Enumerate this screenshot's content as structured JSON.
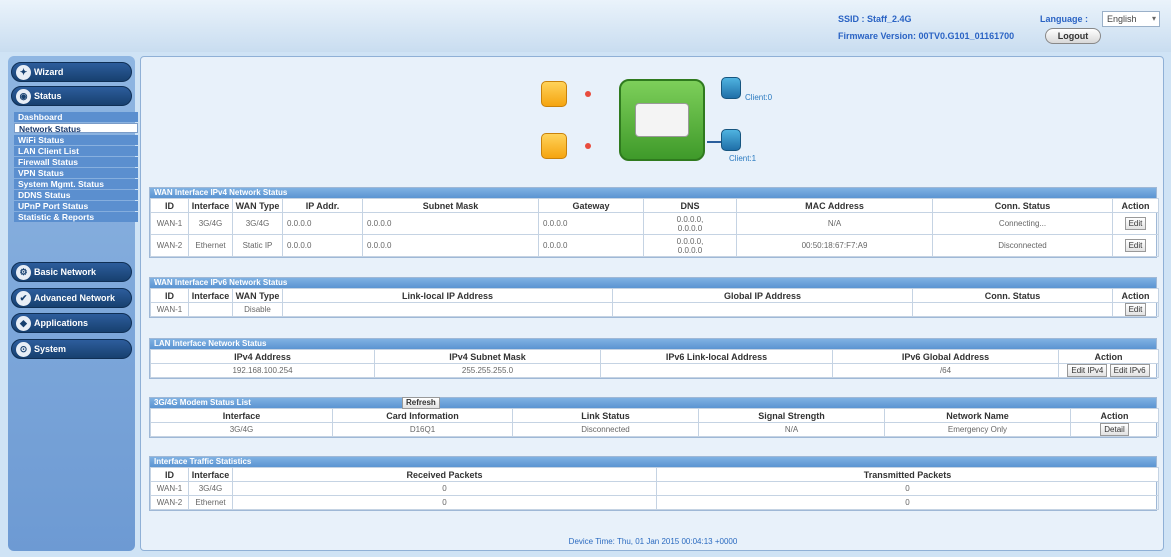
{
  "header": {
    "ssid_label": "SSID : Staff_2.4G",
    "firmware_label": "Firmware Version: 00TV0.G101_01161700",
    "language_label": "Language :",
    "language_value": "English",
    "logout_label": "Logout"
  },
  "sidebar": {
    "wizard": "Wizard",
    "status": "Status",
    "status_items": [
      "Dashboard",
      "Network Status",
      "WiFi Status",
      "LAN Client List",
      "Firewall Status",
      "VPN Status",
      "System Mgmt. Status",
      "DDNS Status",
      "UPnP Port Status",
      "Statistic & Reports"
    ],
    "basic_network": "Basic Network",
    "advanced_network": "Advanced Network",
    "applications": "Applications",
    "system": "System"
  },
  "topology": {
    "client0": "Client:0",
    "client1": "Client:1"
  },
  "wan4": {
    "title": "WAN Interface IPv4 Network Status",
    "headers": [
      "ID",
      "Interface",
      "WAN Type",
      "IP Addr.",
      "Subnet Mask",
      "Gateway",
      "DNS",
      "MAC Address",
      "Conn. Status",
      "Action"
    ],
    "rows": [
      {
        "id": "WAN-1",
        "iface": "3G/4G",
        "type": "3G/4G",
        "ip": "0.0.0.0",
        "mask": "0.0.0.0",
        "gw": "0.0.0.0",
        "dns1": "0.0.0.0,",
        "dns2": "0.0.0.0",
        "mac": "N/A",
        "status": "Connecting...",
        "action": "Edit"
      },
      {
        "id": "WAN-2",
        "iface": "Ethernet",
        "type": "Static IP",
        "ip": "0.0.0.0",
        "mask": "0.0.0.0",
        "gw": "0.0.0.0",
        "dns1": "0.0.0.0,",
        "dns2": "0.0.0.0",
        "mac": "00:50:18:67:F7:A9",
        "status": "Disconnected",
        "action": "Edit"
      }
    ]
  },
  "wan6": {
    "title": "WAN Interface IPv6 Network Status",
    "headers": [
      "ID",
      "Interface",
      "WAN Type",
      "Link-local IP Address",
      "Global IP Address",
      "Conn. Status",
      "Action"
    ],
    "rows": [
      {
        "id": "WAN-1",
        "iface": "",
        "type": "Disable",
        "link": "",
        "global": "",
        "status": "",
        "action": "Edit"
      }
    ]
  },
  "lan": {
    "title": "LAN Interface Network Status",
    "headers": [
      "IPv4 Address",
      "IPv4 Subnet Mask",
      "IPv6 Link-local Address",
      "IPv6 Global Address",
      "Action"
    ],
    "row": {
      "ipv4": "192.168.100.254",
      "mask": "255.255.255.0",
      "link": "",
      "global": "/64",
      "edit4": "Edit IPv4",
      "edit6": "Edit IPv6"
    }
  },
  "modem": {
    "title": "3G/4G Modem Status List",
    "refresh": "Refresh",
    "headers": [
      "Interface",
      "Card Information",
      "Link Status",
      "Signal Strength",
      "Network Name",
      "Action"
    ],
    "row": {
      "iface": "3G/4G",
      "card": "D16Q1",
      "link": "Disconnected",
      "signal": "N/A",
      "network": "Emergency Only",
      "action": "Detail"
    }
  },
  "traffic": {
    "title": "Interface Traffic Statistics",
    "headers": [
      "ID",
      "Interface",
      "Received Packets",
      "Transmitted Packets"
    ],
    "rows": [
      {
        "id": "WAN-1",
        "iface": "3G/4G",
        "rx": "0",
        "tx": "0"
      },
      {
        "id": "WAN-2",
        "iface": "Ethernet",
        "rx": "0",
        "tx": "0"
      }
    ]
  },
  "device_time": "Device Time: Thu, 01 Jan 2015 00:04:13 +0000"
}
